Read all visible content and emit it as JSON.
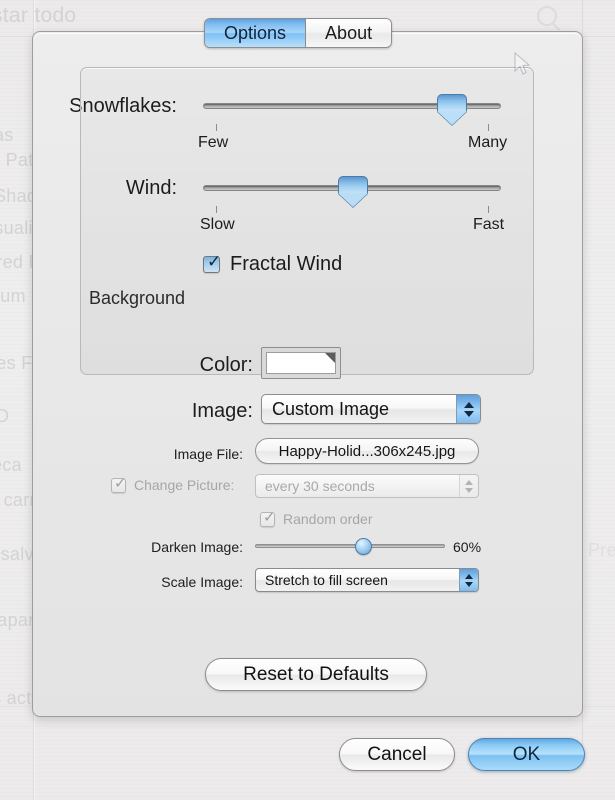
{
  "window": {
    "tabs": [
      {
        "label": "Options",
        "selected": true
      },
      {
        "label": "About",
        "selected": false
      }
    ]
  },
  "snowflakes": {
    "label": "Snowflakes:",
    "min_label": "Few",
    "max_label": "Many",
    "value_percent": 82
  },
  "wind": {
    "label": "Wind:",
    "min_label": "Slow",
    "max_label": "Fast",
    "value_percent": 50
  },
  "fractal_wind": {
    "label": "Fractal Wind",
    "checked": true
  },
  "background": {
    "group_label": "Background",
    "color": {
      "label": "Color:",
      "value": "#FFFFFF"
    },
    "image": {
      "label": "Image:",
      "value": "Custom Image",
      "options": [
        "Custom Image"
      ]
    },
    "image_file": {
      "label": "Image File:",
      "value": "Happy-Holid...306x245.jpg"
    },
    "change_picture": {
      "label": "Change Picture:",
      "checked": true,
      "enabled": false,
      "value": "every 30 seconds",
      "options": [
        "every 30 seconds"
      ]
    },
    "random_order": {
      "label": "Random order",
      "checked": true,
      "enabled": false
    },
    "darken_image": {
      "label": "Darken Image:",
      "value_percent": 60,
      "value_text": "60%"
    },
    "scale_image": {
      "label": "Scale Image:",
      "value": "Stretch to fill screen",
      "options": [
        "Stretch to fill screen"
      ]
    }
  },
  "buttons": {
    "reset": "Reset to Defaults",
    "cancel": "Cancel",
    "ok": "OK"
  },
  "backdrop": {
    "top_text": "star todo",
    "list": [
      "as",
      "e Patterns",
      " Shadow",
      "isualizer",
      "ored Flurries",
      "rum",
      "res Folder",
      "D",
      "eca",
      "o carrete",
      "s salvapantallas",
      "vapantallas"
    ],
    "bottom_text": "s activas...",
    "right_text": "Pre"
  },
  "colors": {
    "accent": "#7fbdf2",
    "sheet_bg": "#e9e9e9",
    "text": "#1d1d1d",
    "disabled_text": "#a6a6a6"
  }
}
